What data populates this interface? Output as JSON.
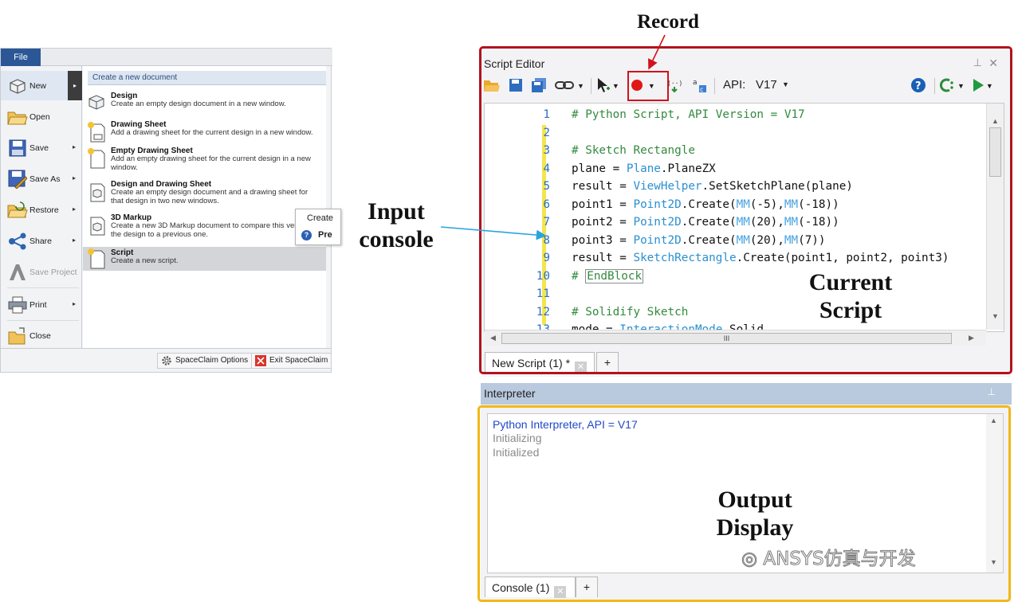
{
  "annotations": {
    "record": "Record",
    "input_line1": "Input",
    "input_line2": "console",
    "current_line1": "Current",
    "current_line2": "Script",
    "output_line1": "Output",
    "output_line2": "Display"
  },
  "file_menu": {
    "tab": "File",
    "items": [
      {
        "label": "New",
        "icon": "new-icon"
      },
      {
        "label": "Open",
        "icon": "folder-open-icon"
      },
      {
        "label": "Save",
        "icon": "floppy-icon"
      },
      {
        "label": "Save As",
        "icon": "floppy-pencil-icon"
      },
      {
        "label": "Restore",
        "icon": "folder-restore-icon"
      },
      {
        "label": "Share",
        "icon": "share-icon"
      },
      {
        "label": "Save Project",
        "icon": "ansys-logo-icon"
      },
      {
        "label": "Print",
        "icon": "printer-icon"
      },
      {
        "label": "Close",
        "icon": "close-folder-icon"
      }
    ],
    "header": "Create a new document",
    "docs": [
      {
        "title": "Design",
        "desc": "Create an empty design document in a new window."
      },
      {
        "title": "Drawing Sheet",
        "desc": "Add a drawing sheet for the current design in a new window."
      },
      {
        "title": "Empty Drawing Sheet",
        "desc": "Add an empty drawing sheet for the current design in a new window."
      },
      {
        "title": "Design and Drawing Sheet",
        "desc": "Create an empty design document and a drawing sheet for that design in two new windows."
      },
      {
        "title": "3D Markup",
        "desc": "Create a new 3D Markup document to compare this version of the design to a previous one."
      },
      {
        "title": "Script",
        "desc": "Create a new script."
      }
    ],
    "options_button": "SpaceClaim Options",
    "exit_button": "Exit SpaceClaim",
    "popup_line1": "Create",
    "popup_line2": "Pre"
  },
  "editor": {
    "title": "Script Editor",
    "api_label": "API:",
    "api_version": "V17",
    "lines": [
      {
        "n": "1",
        "segs": [
          {
            "t": "# Python Script, API Version = V17",
            "c": "com"
          }
        ]
      },
      {
        "n": "2",
        "segs": []
      },
      {
        "n": "3",
        "segs": [
          {
            "t": "# Sketch Rectangle",
            "c": "com"
          }
        ]
      },
      {
        "n": "4",
        "segs": [
          {
            "t": "plane = ",
            "c": "id"
          },
          {
            "t": "Plane",
            "c": "cls"
          },
          {
            "t": ".PlaneZX",
            "c": "id"
          }
        ]
      },
      {
        "n": "5",
        "segs": [
          {
            "t": "result = ",
            "c": "id"
          },
          {
            "t": "ViewHelper",
            "c": "cls"
          },
          {
            "t": ".SetSketchPlane(plane)",
            "c": "id"
          }
        ]
      },
      {
        "n": "6",
        "segs": [
          {
            "t": "point1 = ",
            "c": "id"
          },
          {
            "t": "Point2D",
            "c": "cls"
          },
          {
            "t": ".Create(",
            "c": "id"
          },
          {
            "t": "MM",
            "c": "mm"
          },
          {
            "t": "(-5),",
            "c": "id"
          },
          {
            "t": "MM",
            "c": "mm"
          },
          {
            "t": "(-18))",
            "c": "id"
          }
        ]
      },
      {
        "n": "7",
        "segs": [
          {
            "t": "point2 = ",
            "c": "id"
          },
          {
            "t": "Point2D",
            "c": "cls"
          },
          {
            "t": ".Create(",
            "c": "id"
          },
          {
            "t": "MM",
            "c": "mm"
          },
          {
            "t": "(20),",
            "c": "id"
          },
          {
            "t": "MM",
            "c": "mm"
          },
          {
            "t": "(-18))",
            "c": "id"
          }
        ]
      },
      {
        "n": "8",
        "segs": [
          {
            "t": "point3 = ",
            "c": "id"
          },
          {
            "t": "Point2D",
            "c": "cls"
          },
          {
            "t": ".Create(",
            "c": "id"
          },
          {
            "t": "MM",
            "c": "mm"
          },
          {
            "t": "(20),",
            "c": "id"
          },
          {
            "t": "MM",
            "c": "mm"
          },
          {
            "t": "(7))",
            "c": "id"
          }
        ]
      },
      {
        "n": "9",
        "segs": [
          {
            "t": "result = ",
            "c": "id"
          },
          {
            "t": "SketchRectangle",
            "c": "cls"
          },
          {
            "t": ".Create(point1, point2, point3)",
            "c": "id"
          }
        ]
      },
      {
        "n": "10",
        "segs": [
          {
            "t": "# ",
            "c": "com"
          },
          {
            "t": "EndBlock",
            "c": "com-box"
          }
        ]
      },
      {
        "n": "11",
        "segs": []
      },
      {
        "n": "12",
        "segs": [
          {
            "t": "# Solidify Sketch",
            "c": "com"
          }
        ]
      },
      {
        "n": "13",
        "segs": [
          {
            "t": "mode = ",
            "c": "id"
          },
          {
            "t": "InteractionMode",
            "c": "cls"
          },
          {
            "t": ".Solid",
            "c": "id"
          }
        ]
      }
    ],
    "tab_label": "New Script (1) *",
    "hscroll_grip": "III"
  },
  "interpreter": {
    "title": "Interpreter",
    "output": [
      "Python Interpreter, API = V17",
      "Initializing",
      "Initialized"
    ],
    "tab_label": "Console (1)"
  },
  "watermark": "ANSYS仿真与开发",
  "colors": {
    "record_red": "#d0121b",
    "frame_red": "#b0131e",
    "frame_yellow": "#f3b816",
    "comment_green": "#338a3e",
    "class_blue": "#2a8fd0",
    "line_number_blue": "#2b6fc0"
  }
}
